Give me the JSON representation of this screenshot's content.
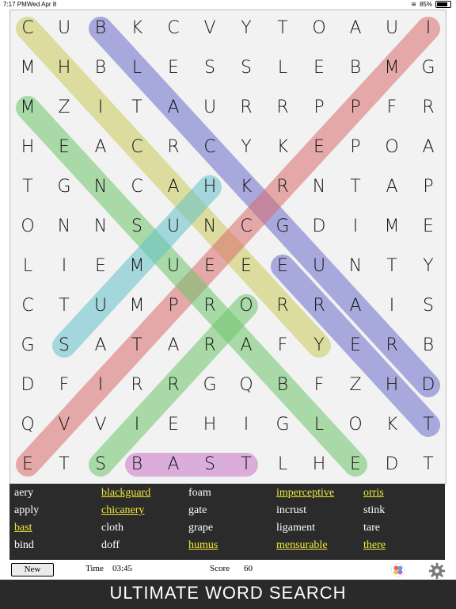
{
  "status": {
    "time": "7:17 PM",
    "date": "Wed Apr 8",
    "battery": "85%"
  },
  "grid": [
    [
      "C",
      "U",
      "B",
      "K",
      "C",
      "V",
      "Y",
      "T",
      "O",
      "A",
      "U",
      "I"
    ],
    [
      "M",
      "H",
      "B",
      "L",
      "E",
      "S",
      "S",
      "L",
      "E",
      "B",
      "M",
      "G"
    ],
    [
      "M",
      "Z",
      "I",
      "T",
      "A",
      "U",
      "R",
      "R",
      "P",
      "P",
      "F",
      "R"
    ],
    [
      "H",
      "E",
      "A",
      "C",
      "R",
      "C",
      "Y",
      "K",
      "E",
      "P",
      "O",
      "A"
    ],
    [
      "T",
      "G",
      "N",
      "C",
      "A",
      "H",
      "K",
      "R",
      "N",
      "T",
      "A",
      "P"
    ],
    [
      "O",
      "N",
      "N",
      "S",
      "U",
      "N",
      "C",
      "G",
      "D",
      "I",
      "M",
      "E"
    ],
    [
      "L",
      "I",
      "E",
      "M",
      "U",
      "E",
      "E",
      "E",
      "U",
      "N",
      "T",
      "Y"
    ],
    [
      "C",
      "T",
      "U",
      "M",
      "P",
      "R",
      "O",
      "R",
      "R",
      "A",
      "I",
      "S"
    ],
    [
      "G",
      "S",
      "A",
      "T",
      "A",
      "R",
      "A",
      "F",
      "Y",
      "E",
      "R",
      "B"
    ],
    [
      "D",
      "F",
      "I",
      "R",
      "R",
      "G",
      "Q",
      "B",
      "F",
      "Z",
      "H",
      "D"
    ],
    [
      "Q",
      "V",
      "V",
      "I",
      "E",
      "H",
      "I",
      "G",
      "L",
      "O",
      "K",
      "T"
    ],
    [
      "E",
      "T",
      "S",
      "B",
      "A",
      "S",
      "T",
      "L",
      "H",
      "E",
      "D",
      "T"
    ]
  ],
  "highlights": [
    {
      "color": "#c9cb5a",
      "from": [
        0,
        0
      ],
      "to": [
        8,
        8
      ]
    },
    {
      "color": "#6a6cc8",
      "from": [
        0,
        2
      ],
      "to": [
        9,
        11
      ]
    },
    {
      "color": "#d96b6b",
      "from": [
        0,
        11
      ],
      "to": [
        11,
        0
      ]
    },
    {
      "color": "#6ec56a",
      "from": [
        2,
        0
      ],
      "to": [
        11,
        9
      ]
    },
    {
      "color": "#62c1c8",
      "from": [
        4,
        5
      ],
      "to": [
        8,
        1
      ]
    },
    {
      "color": "#6a6cc8",
      "from": [
        6,
        7
      ],
      "to": [
        10,
        11
      ]
    },
    {
      "color": "#6ec56a",
      "from": [
        7,
        6
      ],
      "to": [
        11,
        2
      ]
    },
    {
      "color": "#c675c8",
      "from": [
        11,
        3
      ],
      "to": [
        11,
        6
      ]
    }
  ],
  "words": [
    {
      "text": "aery",
      "found": false
    },
    {
      "text": "apply",
      "found": false
    },
    {
      "text": "bast",
      "found": true
    },
    {
      "text": "bind",
      "found": false
    },
    {
      "text": "blackguard",
      "found": true
    },
    {
      "text": "chicanery",
      "found": true
    },
    {
      "text": "cloth",
      "found": false
    },
    {
      "text": "doff",
      "found": false
    },
    {
      "text": "foam",
      "found": false
    },
    {
      "text": "gate",
      "found": false
    },
    {
      "text": "grape",
      "found": false
    },
    {
      "text": "humus",
      "found": true
    },
    {
      "text": "imperceptive",
      "found": true
    },
    {
      "text": "incrust",
      "found": false
    },
    {
      "text": "ligament",
      "found": false
    },
    {
      "text": "mensurable",
      "found": true
    },
    {
      "text": "orris",
      "found": true
    },
    {
      "text": "stink",
      "found": false
    },
    {
      "text": "tare",
      "found": false
    },
    {
      "text": "there",
      "found": true
    }
  ],
  "toolbar": {
    "new_label": "New",
    "time_label": "Time",
    "time_value": "03:45",
    "score_label": "Score",
    "score_value": "60"
  },
  "footer": {
    "title": "ULTIMATE WORD SEARCH"
  },
  "icons": {
    "palette": "color-balls-icon",
    "settings": "gear-icon"
  }
}
